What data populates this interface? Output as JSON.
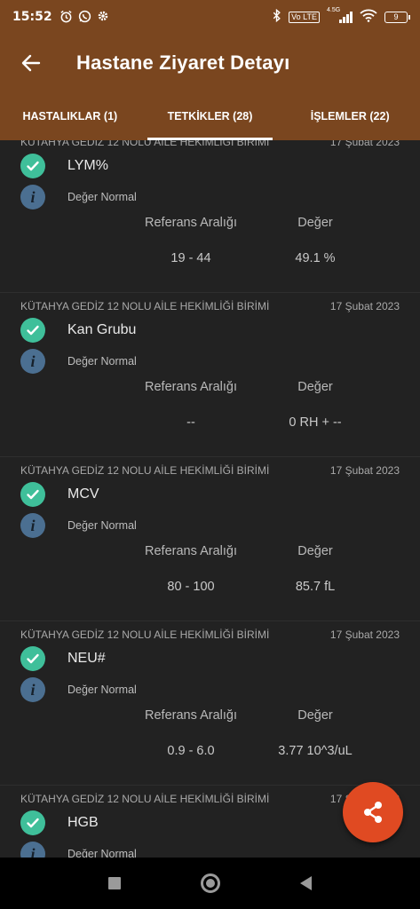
{
  "status_bar": {
    "time": "15:52",
    "left_icons": [
      "alarm-icon",
      "whatsapp-icon",
      "settings-icon"
    ],
    "right_icons": [
      "bluetooth-icon",
      "volte-icon",
      "signal-icon",
      "wifi-icon"
    ],
    "volte_label": "Vo LTE",
    "network_label": "4.5G",
    "battery": "9"
  },
  "app_bar": {
    "title": "Hastane Ziyaret Detayı",
    "color": "#7a461f"
  },
  "tabs": [
    {
      "label": "HASTALIKLAR (1)",
      "active": false
    },
    {
      "label": "TETKİKLER (28)",
      "active": true
    },
    {
      "label": "İŞLEMLER (22)",
      "active": false
    }
  ],
  "columns": {
    "range": "Referans Aralığı",
    "value": "Değer"
  },
  "results": [
    {
      "institution": "KÜTAHYA GEDİZ 12 NOLU AİLE HEKİMLİĞİ BİRİMİ",
      "date": "17 Şubat 2023",
      "name": "LYM%",
      "status": "Değer Normal",
      "range": "19 - 44",
      "value": "49.1 %"
    },
    {
      "institution": "KÜTAHYA GEDİZ 12 NOLU AİLE HEKİMLİĞİ BİRİMİ",
      "date": "17 Şubat 2023",
      "name": "Kan Grubu",
      "status": "Değer Normal",
      "range": "--",
      "value": "0 RH + --"
    },
    {
      "institution": "KÜTAHYA GEDİZ 12 NOLU AİLE HEKİMLİĞİ BİRİMİ",
      "date": "17 Şubat 2023",
      "name": "MCV",
      "status": "Değer Normal",
      "range": "80 - 100",
      "value": "85.7 fL"
    },
    {
      "institution": "KÜTAHYA GEDİZ 12 NOLU AİLE HEKİMLİĞİ BİRİMİ",
      "date": "17 Şubat 2023",
      "name": "NEU#",
      "status": "Değer Normal",
      "range": "0.9 - 6.0",
      "value": "3.77 10^3/uL"
    },
    {
      "institution": "KÜTAHYA GEDİZ 12 NOLU AİLE HEKİMLİĞİ BİRİMİ",
      "date": "17 Şubat 2023",
      "name": "HGB",
      "status": "Değer Normal",
      "range": "",
      "value": ""
    }
  ],
  "fab": {
    "icon": "share-icon",
    "color": "#e04a22"
  },
  "accent": {
    "check": "#3fbf9a",
    "info": "#4b6f91"
  }
}
